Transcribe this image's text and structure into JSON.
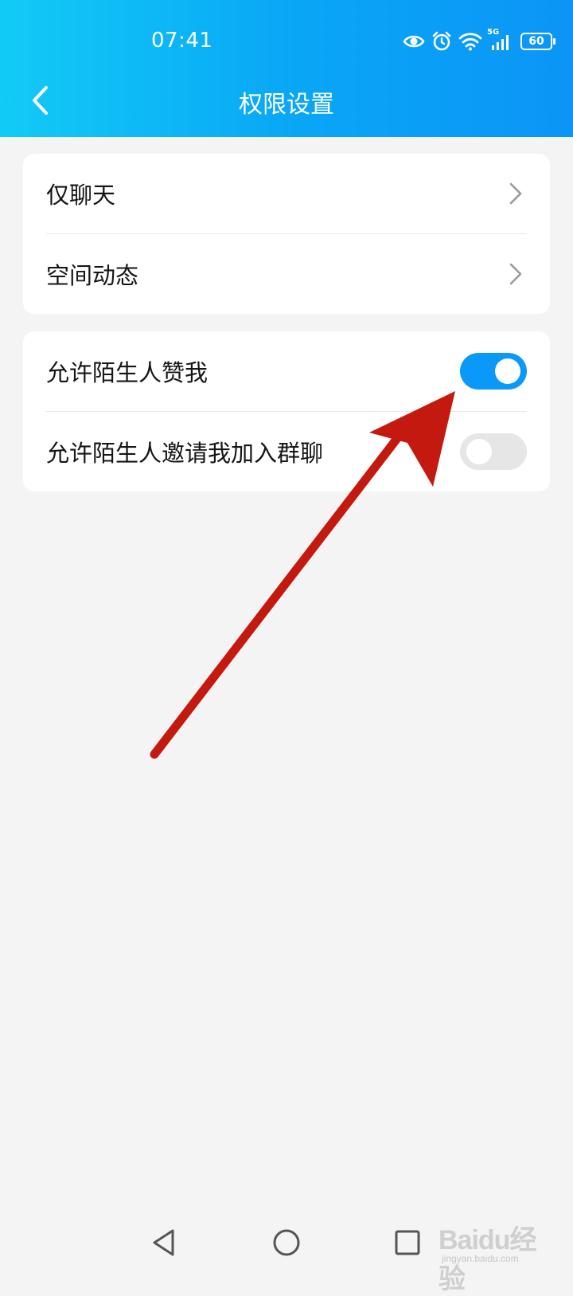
{
  "status_bar": {
    "time": "07:41",
    "network": "5G",
    "battery": "60",
    "icons": [
      "eye-icon",
      "alarm-icon",
      "wifi-icon",
      "signal-icon",
      "battery-icon"
    ]
  },
  "header": {
    "title": "权限设置",
    "back_icon": "chevron-left-icon",
    "gradient": [
      "#12cbf6",
      "#0b95f6"
    ]
  },
  "sections": [
    {
      "items": [
        {
          "label": "仅聊天",
          "type": "link"
        },
        {
          "label": "空间动态",
          "type": "link"
        }
      ]
    },
    {
      "items": [
        {
          "label": "允许陌生人赞我",
          "type": "toggle",
          "on": true
        },
        {
          "label": "允许陌生人邀请我加入群聊",
          "type": "toggle",
          "on": false
        }
      ]
    }
  ],
  "colors": {
    "toggle_on": "#0a99f8",
    "toggle_off": "#e6e6e6",
    "annotation_arrow": "#c4190f",
    "background": "#f4f4f4"
  },
  "nav_bar": {
    "buttons": [
      "back-triangle-icon",
      "home-circle-icon",
      "recents-square-icon"
    ]
  },
  "watermark": {
    "logo": "Baidu经验",
    "url": "jingyan.baidu.com"
  }
}
